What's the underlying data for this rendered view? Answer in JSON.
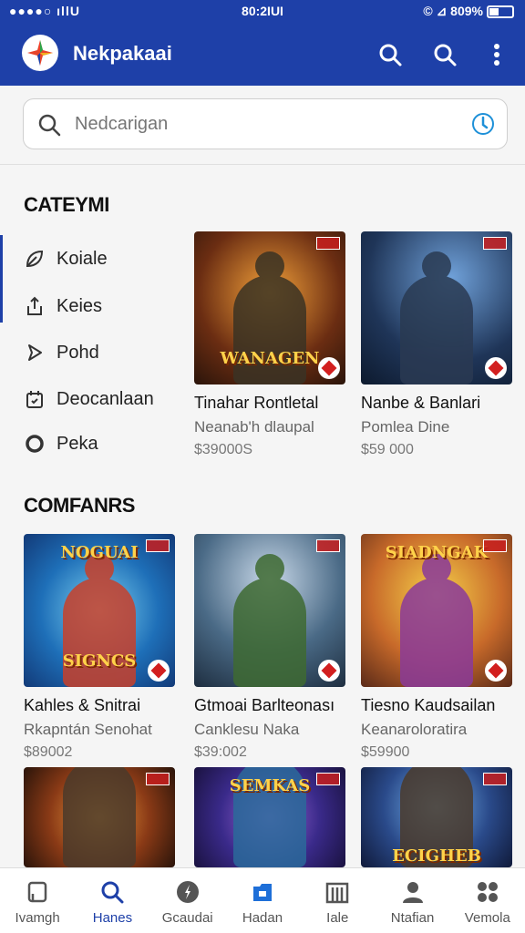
{
  "status_bar": {
    "left": "●●●●○ ıllU",
    "time": "80:2IUI",
    "right": "© ⊿ 809%"
  },
  "app_bar": {
    "title": "Nekpakaai",
    "actions": [
      "search-icon",
      "search-icon",
      "more-vert-icon"
    ]
  },
  "search": {
    "placeholder": "Nedcarigan",
    "value": ""
  },
  "categories": {
    "title": "CATEYMI",
    "items": [
      {
        "label": "Koiale",
        "icon": "leaf-icon"
      },
      {
        "label": "Keies",
        "icon": "share-icon"
      },
      {
        "label": "Pohd",
        "icon": "play-icon"
      },
      {
        "label": "Deocanlaan",
        "icon": "calendar-icon"
      },
      {
        "label": "Peka",
        "icon": "circle-icon"
      }
    ]
  },
  "featured": [
    {
      "title": "Tinahar Rontletal",
      "subtitle": "Neanab'h dlaupal",
      "price": "$39000S",
      "caption": "WANAGEN"
    },
    {
      "title": "Nanbe & Banlari",
      "subtitle": "Pomlea Dine",
      "price": "$59 000",
      "caption": ""
    }
  ],
  "companies": {
    "title": "COMFANRS",
    "items": [
      {
        "title": "Kahles & Snitrai",
        "subtitle": "Rkapntán Senohat",
        "price": "$89002",
        "caption_top": "NOGUAI",
        "caption": "SIGNCS"
      },
      {
        "title": "Gtmoai Barlteonası",
        "subtitle": "Canklesu Naka",
        "price": "$39:002",
        "caption_top": "",
        "caption": ""
      },
      {
        "title": "Tiesno Kaudsailan",
        "subtitle": "Keanaroloratira",
        "price": "$59900",
        "caption_top": "SIADNGAK",
        "caption": ""
      }
    ]
  },
  "more_cards": [
    {
      "caption": ""
    },
    {
      "caption": "SEMKAS"
    },
    {
      "caption": "ECIGHEB"
    }
  ],
  "bottom_nav": [
    {
      "label": "Ivamgh",
      "icon": "book-icon",
      "active": false
    },
    {
      "label": "Hanes",
      "icon": "search-icon",
      "active": true
    },
    {
      "label": "Gcaudai",
      "icon": "compass-icon",
      "active": false
    },
    {
      "label": "Hadan",
      "icon": "folder-icon",
      "active": false
    },
    {
      "label": "Iale",
      "icon": "building-icon",
      "active": false
    },
    {
      "label": "Ntafian",
      "icon": "person-icon",
      "active": false
    },
    {
      "label": "Vemola",
      "icon": "grid-icon",
      "active": false
    }
  ],
  "colors": {
    "primary": "#1e40a8",
    "background": "#f5f5f5"
  }
}
